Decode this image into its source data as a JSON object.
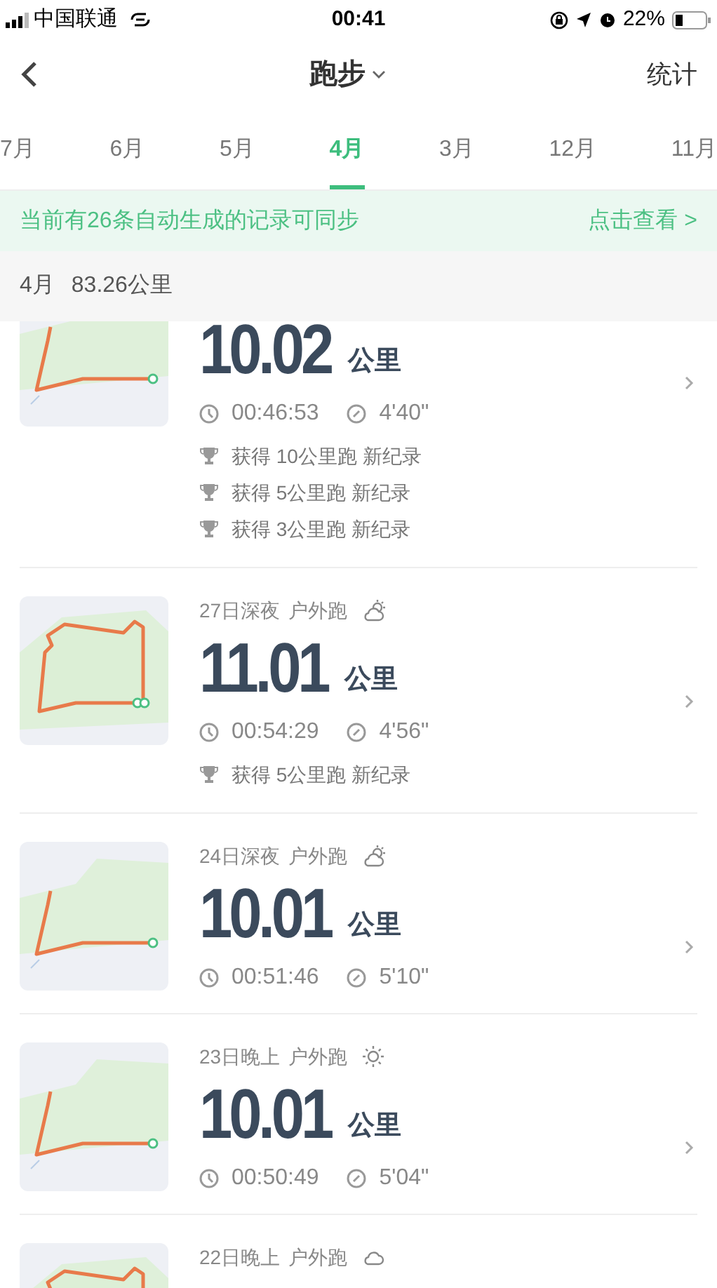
{
  "status_bar": {
    "carrier": "中国联通",
    "time": "00:41",
    "battery": "22%"
  },
  "nav": {
    "title": "跑步",
    "right": "统计"
  },
  "tabs": [
    {
      "label": "7月",
      "selected": false
    },
    {
      "label": "6月",
      "selected": false
    },
    {
      "label": "5月",
      "selected": false
    },
    {
      "label": "4月",
      "selected": true
    },
    {
      "label": "3月",
      "selected": false
    },
    {
      "label": "12月",
      "selected": false
    },
    {
      "label": "11月",
      "selected": false
    }
  ],
  "sync_banner": {
    "message": "当前有26条自动生成的记录可同步",
    "action": "点击查看 >"
  },
  "month_summary": {
    "month": "4月",
    "total": "83.26公里"
  },
  "runs": [
    {
      "distance": "10.02",
      "unit": "公里",
      "duration": "00:46:53",
      "pace": "4'40\"",
      "records": [
        "获得 10公里跑 新纪录",
        "获得 5公里跑 新纪录",
        "获得 3公里跑 新纪录"
      ]
    },
    {
      "date": "27日深夜",
      "type": "户外跑",
      "weather_icon": {
        "kind": "partly_cloudy"
      },
      "distance": "11.01",
      "unit": "公里",
      "duration": "00:54:29",
      "pace": "4'56\"",
      "records": [
        "获得 5公里跑 新纪录"
      ]
    },
    {
      "date": "24日深夜",
      "type": "户外跑",
      "weather_icon": {
        "kind": "partly_cloudy"
      },
      "distance": "10.01",
      "unit": "公里",
      "duration": "00:51:46",
      "pace": "5'10\""
    },
    {
      "date": "23日晚上",
      "type": "户外跑",
      "weather_icon": {
        "kind": "sunny"
      },
      "distance": "10.01",
      "unit": "公里",
      "duration": "00:50:49",
      "pace": "5'04\""
    },
    {
      "date": "22日晚上",
      "type": "户外跑",
      "weather_icon": {
        "kind": "cloudy"
      }
    }
  ]
}
